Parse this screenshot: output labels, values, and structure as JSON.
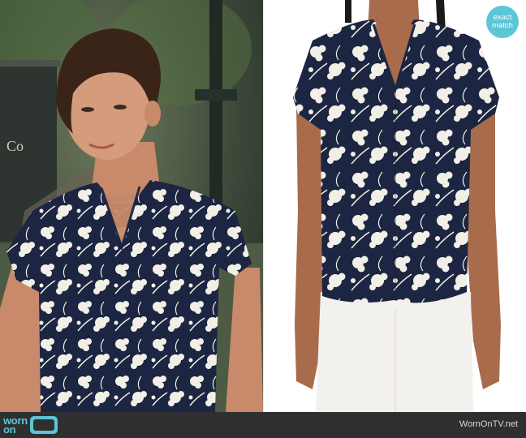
{
  "badge": {
    "line1": "exact",
    "line2": "match"
  },
  "footer": {
    "logo_line1": "worn",
    "logo_line2": "on",
    "site_url": "WornOnTV.net"
  },
  "sign_text": "Co",
  "colors": {
    "accent": "#5cc6d6",
    "navy": "#1c2541",
    "footer_bg": "#2f2f2f"
  },
  "icons": {
    "logo": "tv-icon"
  }
}
